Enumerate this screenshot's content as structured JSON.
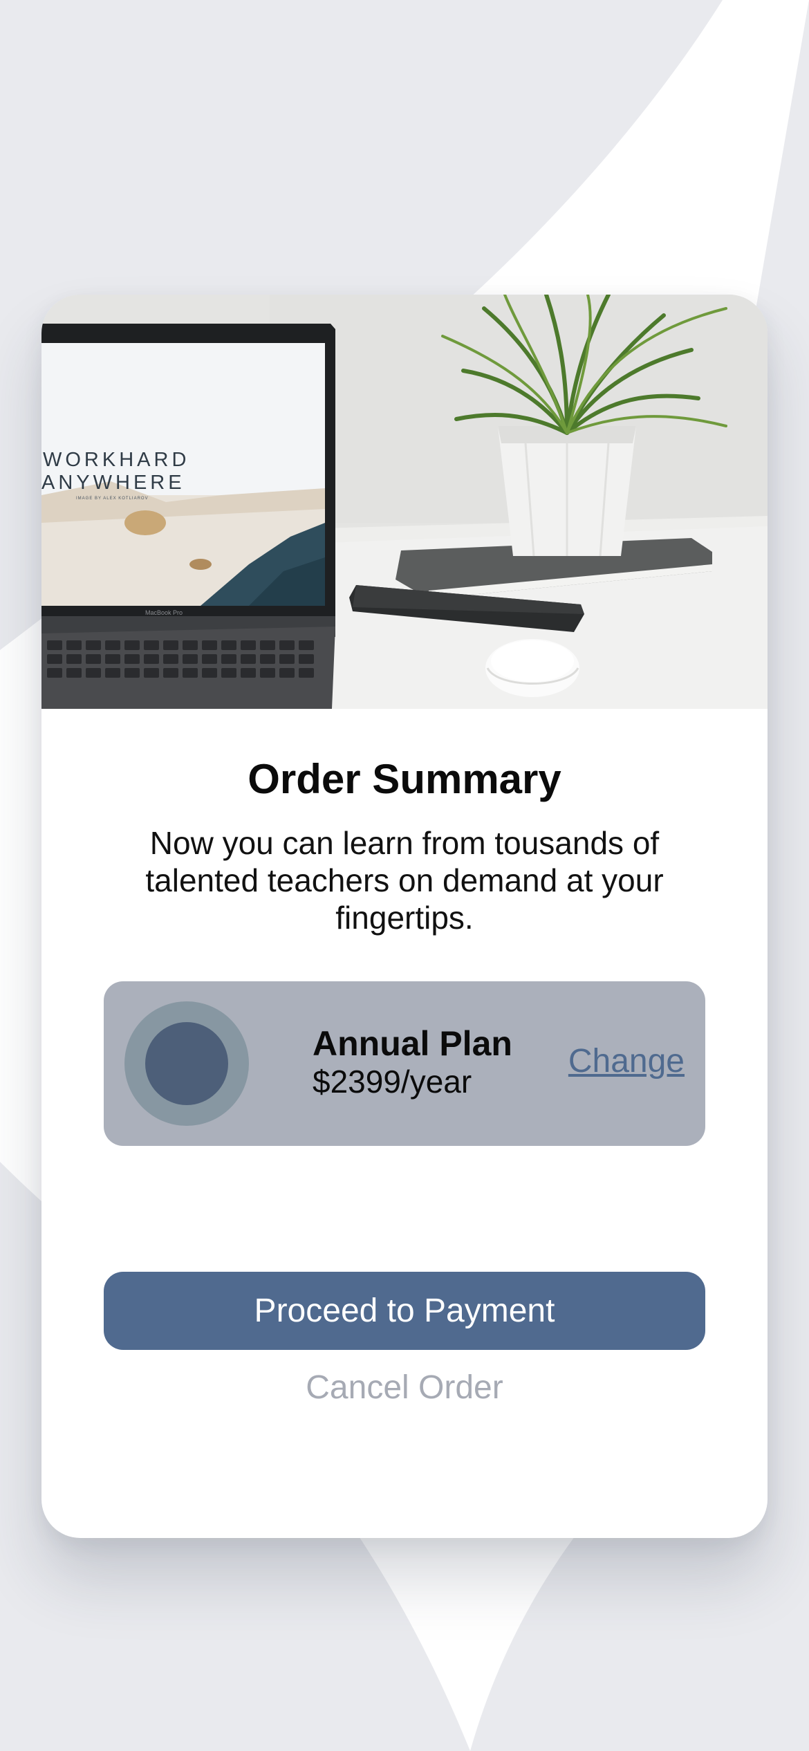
{
  "hero": {
    "screen_text_line1": "WORKHARD",
    "screen_text_line2": "ANYWHERE",
    "screen_small_text": "IMAGE BY ALEX KOTLIAROV",
    "laptop_label": "MacBook Pro"
  },
  "order": {
    "title": "Order Summary",
    "description": "Now you can learn from tousands of talented teachers on demand at your fingertips."
  },
  "plan": {
    "name": "Annual Plan",
    "price": "$2399/year",
    "change_label": "Change"
  },
  "actions": {
    "proceed_label": "Proceed to Payment",
    "cancel_label": "Cancel Order"
  },
  "colors": {
    "background": "#e9eaee",
    "card": "#ffffff",
    "plan_box": "#abb0bb",
    "accent": "#506a8f",
    "cancel_text": "#a6aab4"
  }
}
